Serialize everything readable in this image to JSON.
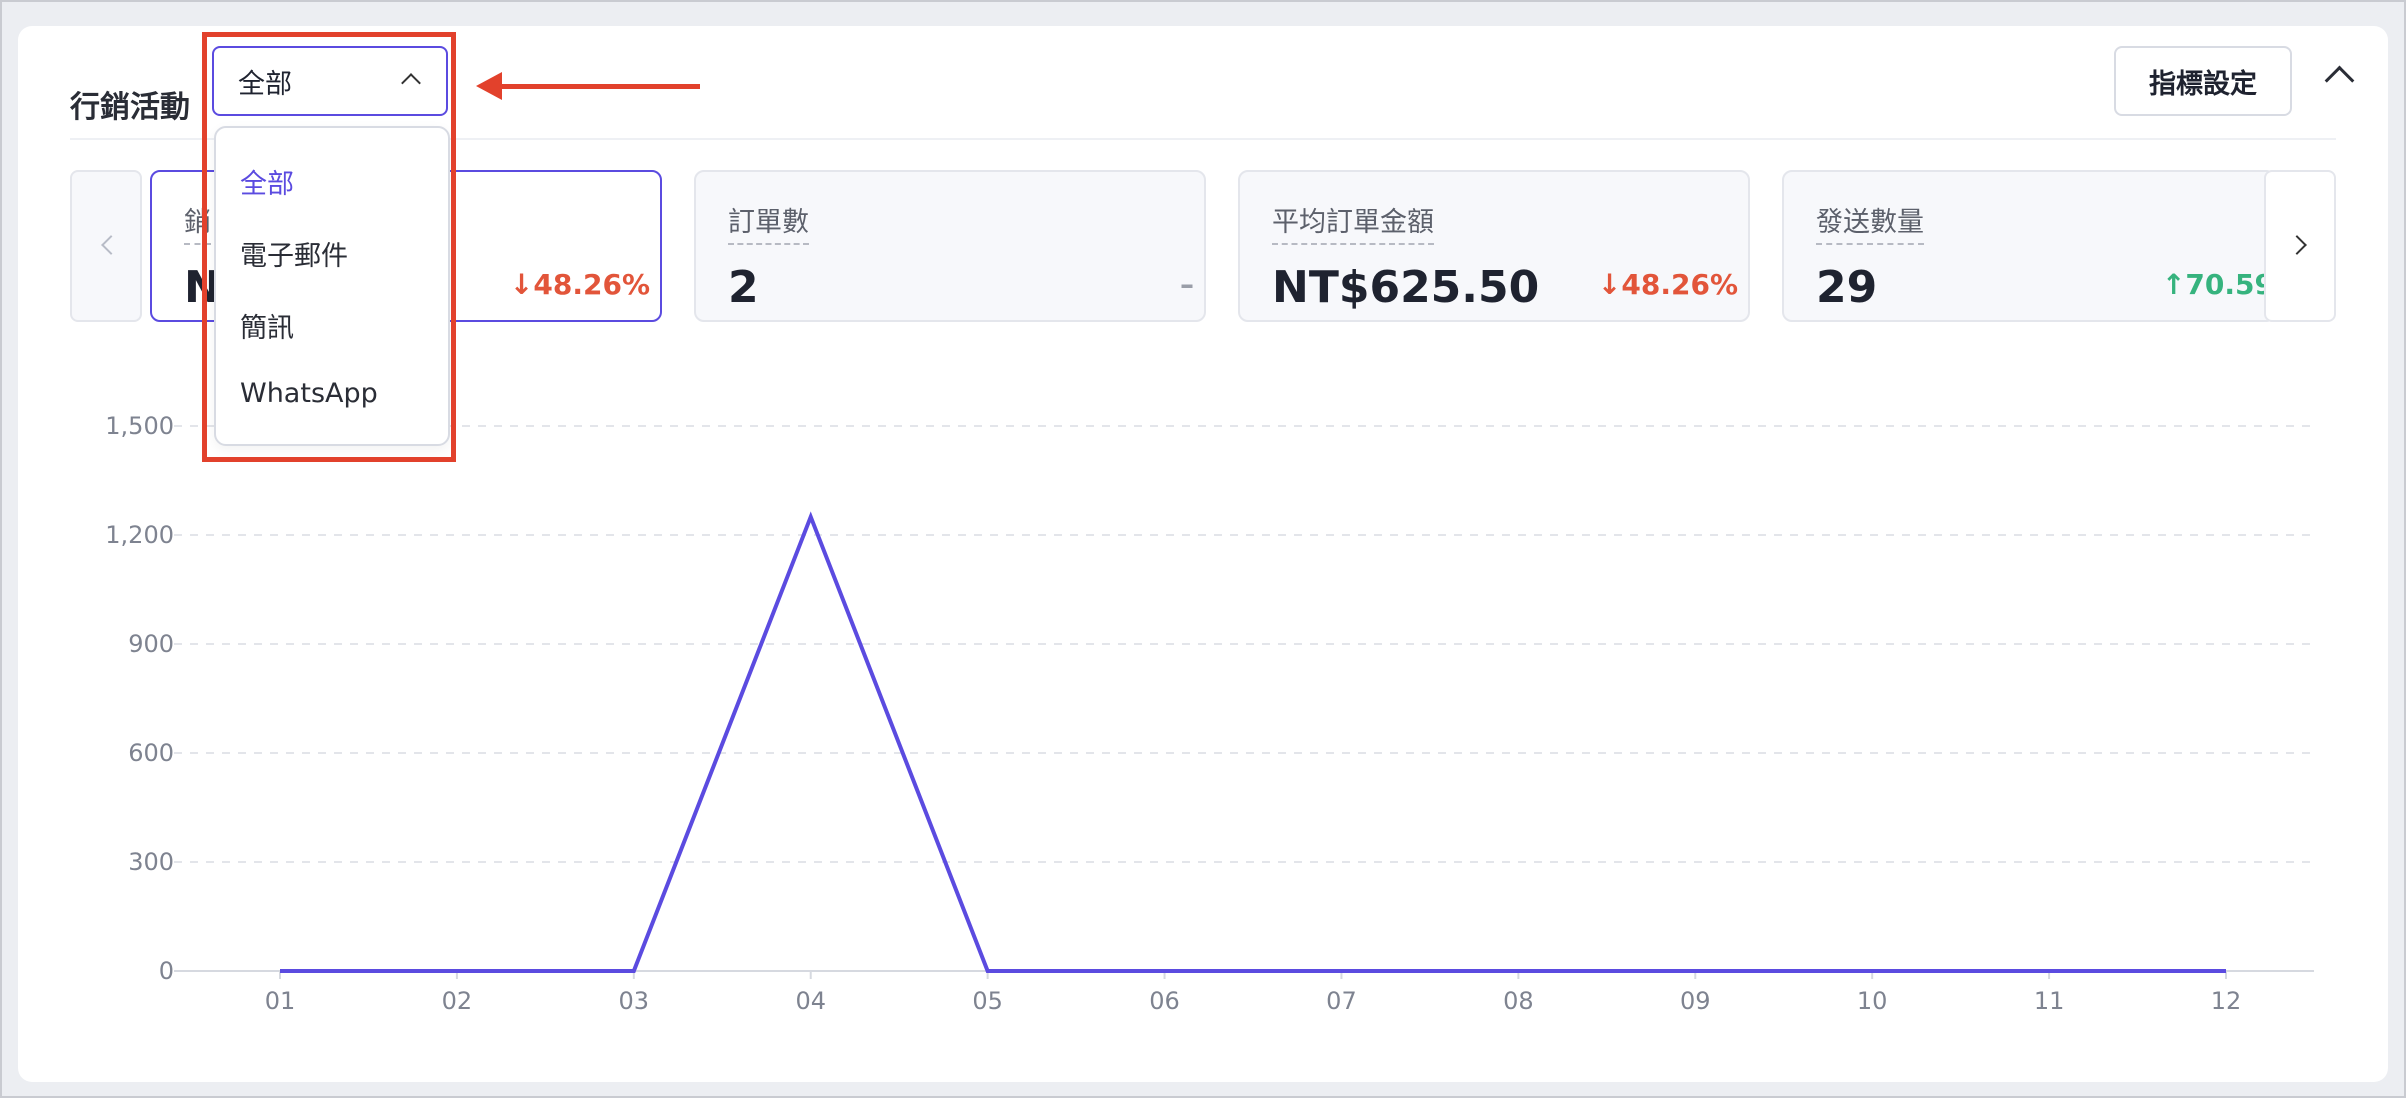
{
  "header": {
    "title": "行銷活動",
    "metric_settings_label": "指標設定",
    "collapse_icon": "chevron-up-icon"
  },
  "channel_select": {
    "value": "全部",
    "open": true,
    "options": [
      "全部",
      "電子郵件",
      "簡訊",
      "WhatsApp"
    ],
    "selected_index": 0
  },
  "kpis": [
    {
      "label": "銷",
      "value": "N",
      "change": "48.26%",
      "direction": "down"
    },
    {
      "label": "訂單數",
      "value": "2",
      "change": "–",
      "direction": "flat"
    },
    {
      "label": "平均訂單金額",
      "value": "NT$625.50",
      "change": "48.26%",
      "direction": "down"
    },
    {
      "label": "發送數量",
      "value": "29",
      "change": "70.59",
      "direction": "up"
    }
  ],
  "colors": {
    "accent": "#5b4be0",
    "down": "#e2553a",
    "up": "#36b37e",
    "annotation": "#e2412c"
  },
  "chart_data": {
    "type": "line",
    "x": [
      "01",
      "02",
      "03",
      "04",
      "05",
      "06",
      "07",
      "08",
      "09",
      "10",
      "11",
      "12"
    ],
    "series": [
      {
        "values": [
          0,
          0,
          0,
          1250,
          0,
          0,
          0,
          0,
          0,
          0,
          0,
          0
        ]
      }
    ],
    "yticks": [
      "0",
      "300",
      "600",
      "900",
      "1,200",
      "1,500"
    ],
    "ylim": [
      0,
      1500
    ],
    "grid": true,
    "title": "",
    "xlabel": "",
    "ylabel": ""
  }
}
